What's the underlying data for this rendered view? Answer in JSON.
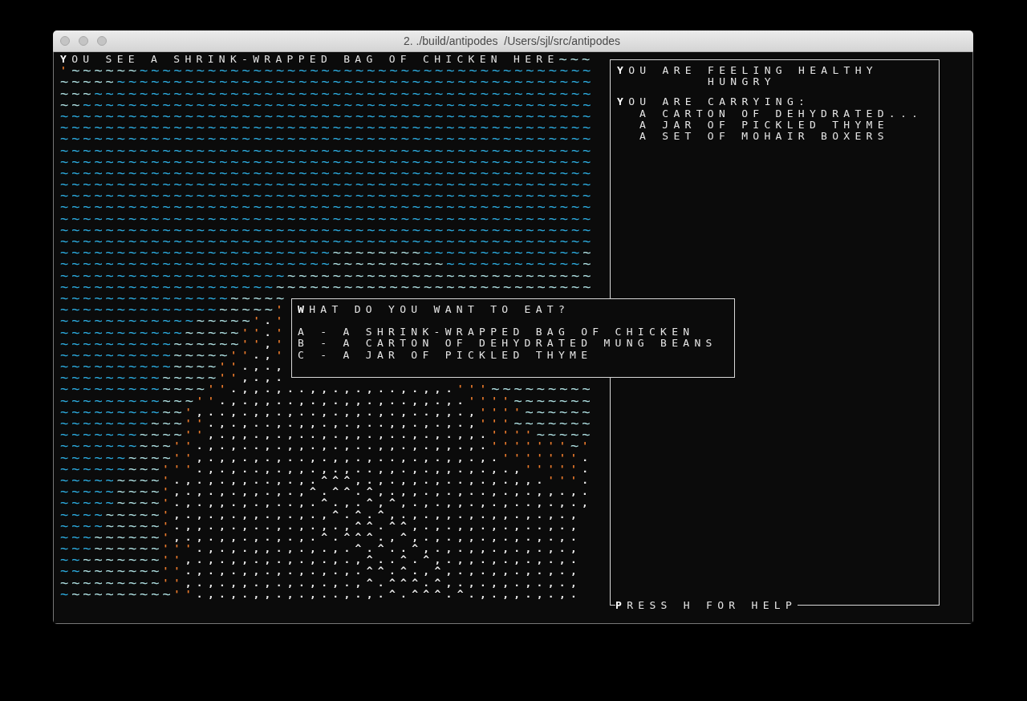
{
  "window": {
    "title": "2. ./build/antipodes  /Users/sjl/src/antipodes"
  },
  "map": {
    "rows": [
      [
        {
          "kind": "message",
          "text": "YOU SEE A SHRINK-WRAPPED BAG OF CHICKEN HERE"
        },
        {
          "kind": "pale",
          "text": "~~~"
        }
      ],
      [
        {
          "kind": "shore",
          "text": "'"
        },
        {
          "kind": "pale",
          "text": "~~~~~~"
        },
        {
          "kind": "deep",
          "text": "~~~~~~~~~~~~~~~~~~~~~~~~~~~~~~~~~~~~~~~~"
        }
      ],
      [
        {
          "kind": "pale",
          "text": "~~~~~"
        },
        {
          "kind": "deep",
          "text": "~~~~~~~~~~~~~~~~~~~~~~~~~~~~~~~~~~~~~~~~~~"
        }
      ],
      [
        {
          "kind": "pale",
          "text": "~~~"
        },
        {
          "kind": "deep",
          "text": "~~~~~~~~~~~~~~~~~~~~~~~~~~~~~~~~~~~~~~~~~~~~"
        }
      ],
      [
        {
          "kind": "pale",
          "text": "~~"
        },
        {
          "kind": "deep",
          "text": "~~~~~~~~~~~~~~~~~~~~~~~~~~~~~~~~~~~~~~~~~~~~~"
        }
      ],
      [
        {
          "kind": "deep",
          "text": "~~~~~~~~~~~~~~~~~~~~~~~~~~~~~~~~~~~~~~~~~~~~~~~"
        }
      ],
      [
        {
          "kind": "deep",
          "text": "~~~~~~~~~~~~~~~~~~~~~~~~~~~~~~~~~~~~~~~~~~~~~~~"
        }
      ],
      [
        {
          "kind": "deep",
          "text": "~~~~~~~~~~~~~~~~~~~~~~~~~~~~~~~~~~~~~~~~~~~~~~~"
        }
      ],
      [
        {
          "kind": "deep",
          "text": "~~~~~~~~~~~~~~~~~~~~~~~~~~~~~~~~~~~~~~~~~~~~~~~"
        }
      ],
      [
        {
          "kind": "deep",
          "text": "~~~~~~~~~~~~~~~~~~~~~~~~~~~~~~~~~~~~~~~~~~~~~~~"
        }
      ],
      [
        {
          "kind": "deep",
          "text": "~~~~~~~~~~~~~~~~~~~~~~~~~~~~~~~~~~~~~~~~~~~~~~~"
        }
      ],
      [
        {
          "kind": "deep",
          "text": "~~~~~~~~~~~~~~~~~~~~~~~~~~~~~~~~~~~~~~~~~~~~~~~"
        }
      ],
      [
        {
          "kind": "deep",
          "text": "~~~~~~~~~~~~~~~~~~~~~~~~~~~~~~~~~~~~~~~~~~~~~~~"
        }
      ],
      [
        {
          "kind": "deep",
          "text": "~~~~~~~~~~~~~~~~~~~~~~~~~~~~~~~~~~~~~~~~~~~~~~~"
        }
      ],
      [
        {
          "kind": "deep",
          "text": "~~~~~~~~~~~~~~~~~~~~~~~~~~~~~~~~~~~~~~~~~~~~~~~"
        }
      ],
      [
        {
          "kind": "deep",
          "text": "~~~~~~~~~~~~~~~~~~~~~~~~~~~~~~~~~~~~~~~~~~~~~~~"
        }
      ],
      [
        {
          "kind": "deep",
          "text": "~~~~~~~~~~~~~~~~~~~~~~~~~~~~~~~~~~~~~~~~~~~~~~~"
        }
      ],
      [
        {
          "kind": "deep",
          "text": "~~~~~~~~~~~~~~~~~~~~~~~~"
        },
        {
          "kind": "pale",
          "text": "~~~~~~~~"
        },
        {
          "kind": "deep",
          "text": "~~~~~~~~~~~~~~"
        },
        {
          "kind": "pale",
          "text": "~"
        }
      ],
      [
        {
          "kind": "deep",
          "text": "~~~~~~~~~~~~~~~~~~~~~~~~"
        },
        {
          "kind": "pale",
          "text": "~~~~~~~~~~"
        },
        {
          "kind": "deep",
          "text": "~~~~~~~~~~~~"
        },
        {
          "kind": "pale",
          "text": "~"
        }
      ],
      [
        {
          "kind": "deep",
          "text": "~~~~~~~~~~~~~~~~~~~~"
        },
        {
          "kind": "pale",
          "text": "~~~~~~~~~~~~~~~~~~~~~~~~~~~"
        }
      ],
      [
        {
          "kind": "deep",
          "text": "~~~~~~~~~~~~~~~~~~~"
        },
        {
          "kind": "pale",
          "text": "~~~~~~~~~~~~~~~~~~~~~~~~~~~~"
        }
      ],
      [
        {
          "kind": "deep",
          "text": "~~~~~~~~~~~~~~~"
        },
        {
          "kind": "pale",
          "text": "~~~~~"
        }
      ],
      [
        {
          "kind": "deep",
          "text": "~~~~~~~~~~~~~~"
        },
        {
          "kind": "pale",
          "text": "~~~~~"
        },
        {
          "kind": "shore",
          "text": "'"
        }
      ],
      [
        {
          "kind": "deep",
          "text": "~~~~~~~~~~~~"
        },
        {
          "kind": "pale",
          "text": "~~~~~"
        },
        {
          "kind": "shore",
          "text": "'"
        },
        {
          "kind": "ground",
          "text": "."
        },
        {
          "kind": "shore",
          "text": "'"
        }
      ],
      [
        {
          "kind": "deep",
          "text": "~~~~~~~~~~~"
        },
        {
          "kind": "pale",
          "text": "~~~~~"
        },
        {
          "kind": "shore",
          "text": "''"
        },
        {
          "kind": "ground",
          "text": "."
        },
        {
          "kind": "shore",
          "text": "'"
        }
      ],
      [
        {
          "kind": "deep",
          "text": "~~~~~~~~~~"
        },
        {
          "kind": "pale",
          "text": "~~~~~~"
        },
        {
          "kind": "shore",
          "text": "''"
        },
        {
          "kind": "ground",
          "text": ","
        },
        {
          "kind": "shore",
          "text": "'"
        }
      ],
      [
        {
          "kind": "deep",
          "text": "~~~~~~~~~~"
        },
        {
          "kind": "pale",
          "text": "~~~~~"
        },
        {
          "kind": "shore",
          "text": "''"
        },
        {
          "kind": "ground",
          "text": ".,"
        },
        {
          "kind": "shore",
          "text": "'"
        }
      ],
      [
        {
          "kind": "deep",
          "text": "~~~~~~~~~~"
        },
        {
          "kind": "pale",
          "text": "~~~~"
        },
        {
          "kind": "shore",
          "text": "''"
        },
        {
          "kind": "ground",
          "text": ".,.,"
        }
      ],
      [
        {
          "kind": "deep",
          "text": "~~~~~~~~~"
        },
        {
          "kind": "pale",
          "text": "~~~~~"
        },
        {
          "kind": "shore",
          "text": "''"
        },
        {
          "kind": "ground",
          "text": ",.,."
        }
      ],
      [
        {
          "kind": "deep",
          "text": "~~~~~~~~~"
        },
        {
          "kind": "pale",
          "text": "~~~~"
        },
        {
          "kind": "shore",
          "text": "''"
        },
        {
          "kind": "ground",
          "text": ".,,.,..,,.,.,..,.,,."
        },
        {
          "kind": "shore",
          "text": "'''"
        },
        {
          "kind": "pale",
          "text": "~~~~~~~~~"
        }
      ],
      [
        {
          "kind": "deep",
          "text": "~~~~~~~~~"
        },
        {
          "kind": "pale",
          "text": "~~~"
        },
        {
          "kind": "shore",
          "text": "''"
        },
        {
          "kind": "ground",
          "text": ".,.,,..,.,.,,.,..,,.,."
        },
        {
          "kind": "shore",
          "text": "''''"
        },
        {
          "kind": "pale",
          "text": "~~~~~~~"
        }
      ],
      [
        {
          "kind": "deep",
          "text": "~~~~~~~~~"
        },
        {
          "kind": "pale",
          "text": "~~"
        },
        {
          "kind": "shore",
          "text": "'"
        },
        {
          "kind": "ground",
          "text": ",..,.,,.,..,.,,.,.,..,,.,"
        },
        {
          "kind": "shore",
          "text": "''''"
        },
        {
          "kind": "pale",
          "text": "~~~~~~"
        }
      ],
      [
        {
          "kind": "deep",
          "text": "~~~~~~~~"
        },
        {
          "kind": "pale",
          "text": "~~~"
        },
        {
          "kind": "shore",
          "text": "''"
        },
        {
          "kind": "ground",
          "text": ".,.,..,.,,.,.,..,,.,.,.,"
        },
        {
          "kind": "shore",
          "text": "'''"
        },
        {
          "kind": "pale",
          "text": "~~~~~~~"
        }
      ],
      [
        {
          "kind": "deep",
          "text": "~~~~~~~"
        },
        {
          "kind": "pale",
          "text": "~~~~"
        },
        {
          "kind": "shore",
          "text": "''"
        },
        {
          "kind": "ground",
          "text": ",.,,.,.,..,.,,.,..,.,.,,."
        },
        {
          "kind": "shore",
          "text": "''''"
        },
        {
          "kind": "pale",
          "text": "~~~~~"
        }
      ],
      [
        {
          "kind": "deep",
          "text": "~~~~~~~"
        },
        {
          "kind": "pale",
          "text": "~~~"
        },
        {
          "kind": "shore",
          "text": "''"
        },
        {
          "kind": "ground",
          "text": ".,.,..,.,,.,.,..,,.,.,,.,."
        },
        {
          "kind": "shore",
          "text": "'''''''"
        },
        {
          "kind": "pale",
          "text": "~"
        },
        {
          "kind": "shore",
          "text": "'"
        }
      ],
      [
        {
          "kind": "deep",
          "text": "~~~~~~"
        },
        {
          "kind": "pale",
          "text": "~~~~"
        },
        {
          "kind": "shore",
          "text": "''"
        },
        {
          "kind": "ground",
          "text": ",.,,.,.,..,.,,.,..,.,.,,.,."
        },
        {
          "kind": "shore",
          "text": "'''''''"
        },
        {
          "kind": "ground",
          "text": "."
        }
      ],
      [
        {
          "kind": "deep",
          "text": "~~~~~~"
        },
        {
          "kind": "pale",
          "text": "~~~"
        },
        {
          "kind": "shore",
          "text": "'''"
        },
        {
          "kind": "ground",
          "text": ".,.,..,.,,.,.,..,,.,.,,.,.,.,"
        },
        {
          "kind": "shore",
          "text": "'''''"
        },
        {
          "kind": "ground",
          "text": "."
        }
      ],
      [
        {
          "kind": "deep",
          "text": "~~~~~"
        },
        {
          "kind": "pale",
          "text": "~~~~"
        },
        {
          "kind": "shore",
          "text": "'"
        },
        {
          "kind": "ground",
          "text": ".,.,.,,..,.,.^^^,.,.,,.,..,.,.,,."
        },
        {
          "kind": "shore",
          "text": "'''"
        },
        {
          "kind": "ground",
          "text": "."
        }
      ],
      [
        {
          "kind": "deep",
          "text": "~~~~~"
        },
        {
          "kind": "pale",
          "text": "~~~~"
        },
        {
          "kind": "shore",
          "text": "'"
        },
        {
          "kind": "ground",
          "text": ",.,.,.,,.,.,^.^^.^,.,,.,.,..,.,.,,.,."
        }
      ],
      [
        {
          "kind": "deep",
          "text": "~~~~~"
        },
        {
          "kind": "pale",
          "text": "~~~~"
        },
        {
          "kind": "shore",
          "text": "'"
        },
        {
          "kind": "ground",
          "text": ".,.,,.,.,..,.^.,.^,^,.,.,,.,.,..,.,.,"
        }
      ],
      [
        {
          "kind": "deep",
          "text": "~~~~"
        },
        {
          "kind": "pale",
          "text": "~~~~~"
        },
        {
          "kind": "shore",
          "text": "'"
        },
        {
          "kind": "ground",
          "text": ",.,.,.,,.,.,.,^.^.^,.,.,,.,.,,.,.,.,"
        }
      ],
      [
        {
          "kind": "deep",
          "text": "~~~~"
        },
        {
          "kind": "pale",
          "text": "~~~~~"
        },
        {
          "kind": "shore",
          "text": "'"
        },
        {
          "kind": "ground",
          "text": ".,,.,.,..,.,.,.,^^.^^,.,.,,.,.,..,.,"
        }
      ],
      [
        {
          "kind": "deep",
          "text": "~~~"
        },
        {
          "kind": "pale",
          "text": "~~~~~~"
        },
        {
          "kind": "shore",
          "text": "'"
        },
        {
          "kind": "ground",
          "text": ",.,.,,.,.,.,.^.^^^.,^,.,.,,.,.,.,.,."
        }
      ],
      [
        {
          "kind": "deep",
          "text": "~~~"
        },
        {
          "kind": "pale",
          "text": "~~~~~~"
        },
        {
          "kind": "shore",
          "text": "'''"
        },
        {
          "kind": "ground",
          "text": ".,.,.,,.,.,.,.^.^..^,.,.,,.,.,.,.,"
        }
      ],
      [
        {
          "kind": "deep",
          "text": "~~"
        },
        {
          "kind": "pale",
          "text": "~~~~~~~"
        },
        {
          "kind": "shore",
          "text": "''"
        },
        {
          "kind": "ground",
          "text": ",.,.,,.,.,.,.,.,^..^.^,.,,.,.,.,.,."
        }
      ],
      [
        {
          "kind": "deep",
          "text": "~~"
        },
        {
          "kind": "pale",
          "text": "~~~~~~~"
        },
        {
          "kind": "shore",
          "text": "''"
        },
        {
          "kind": "ground",
          "text": ".,.,.,,.,.,.,.,.^^.^.,^,.,.,,.,.,.,"
        }
      ],
      [
        {
          "kind": "pale",
          "text": "~~~~~~~~~"
        },
        {
          "kind": "shore",
          "text": "''"
        },
        {
          "kind": "ground",
          "text": ",.,.,,.,.,.,.,.,^.^^^.^,.,.,,.,.,.,"
        }
      ],
      [
        {
          "kind": "deep",
          "text": "~"
        },
        {
          "kind": "pale",
          "text": "~~~~~~~~~"
        },
        {
          "kind": "shore",
          "text": "''"
        },
        {
          "kind": "ground",
          "text": ".,.,.,,.,.,..,.,.^.^^^.^.,.,,.,.,."
        }
      ]
    ]
  },
  "menu": {
    "title": "WHAT DO YOU WANT TO EAT?",
    "options": [
      "A - A SHRINK-WRAPPED BAG OF CHICKEN",
      "B - A CARTON OF DEHYDRATED MUNG BEANS",
      "C - A JAR OF PICKLED THYME"
    ]
  },
  "sidebar": {
    "health": [
      "YOU ARE FEELING HEALTHY",
      "        HUNGRY"
    ],
    "inventory": {
      "heading": "YOU ARE CARRYING:",
      "items": [
        "A CARTON OF DEHYDRATED...",
        "A JAR OF PICKLED THYME",
        "A SET OF MOHAIR BOXERS"
      ]
    },
    "footer": "PRESS H FOR HELP"
  }
}
